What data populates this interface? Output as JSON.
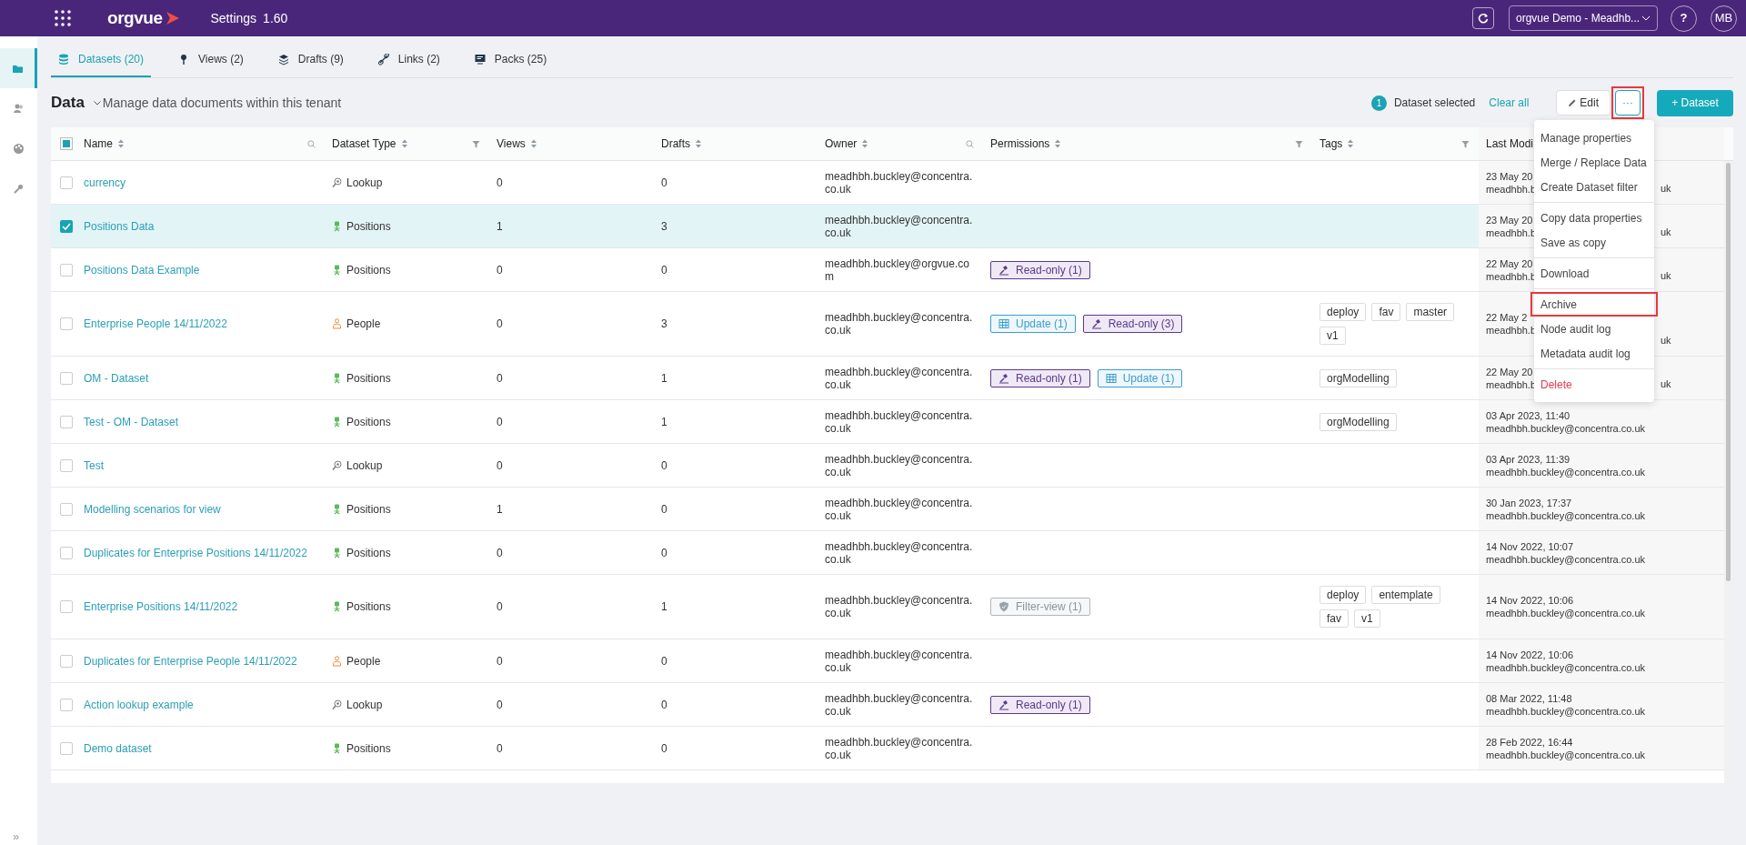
{
  "topbar": {
    "logo": "orgvue",
    "title": "Settings",
    "version": "1.60",
    "tenant": "orgvue Demo - Meadhb...",
    "help": "?",
    "avatar": "MB"
  },
  "sidebar": {
    "items": [
      {
        "kind": "folder",
        "selected": true
      },
      {
        "kind": "people",
        "selected": false
      },
      {
        "kind": "palette",
        "selected": false
      },
      {
        "kind": "wrench",
        "selected": false
      }
    ],
    "expand": "»"
  },
  "tabs": [
    {
      "kind": "database",
      "label": "Datasets (20)",
      "selected": true
    },
    {
      "kind": "pin",
      "label": "Views (2)",
      "selected": false
    },
    {
      "kind": "layers",
      "label": "Drafts (9)",
      "selected": false
    },
    {
      "kind": "link",
      "label": "Links (2)",
      "selected": false
    },
    {
      "kind": "monitor",
      "label": "Packs (25)",
      "selected": false
    }
  ],
  "header": {
    "title": "Data",
    "subtitle": "Manage data documents within this tenant",
    "selected_count": "1",
    "selected_label": "Dataset selected",
    "clear": "Clear all",
    "edit": "Edit",
    "more": {
      "label": "···",
      "highlighted": true
    },
    "add": "+ Dataset"
  },
  "table": {
    "select_all_partial": true,
    "columns": [
      {
        "label": "Name",
        "searchable": true,
        "filterable": false
      },
      {
        "label": "Dataset Type",
        "searchable": false,
        "filterable": true
      },
      {
        "label": "Views",
        "searchable": false,
        "filterable": false
      },
      {
        "label": "Drafts",
        "searchable": false,
        "filterable": false
      },
      {
        "label": "Owner",
        "searchable": true,
        "filterable": false
      },
      {
        "label": "Permissions",
        "searchable": false,
        "filterable": true
      },
      {
        "label": "Tags",
        "searchable": false,
        "filterable": true
      },
      {
        "label": "Last Modi",
        "searchable": false,
        "filterable": false
      }
    ],
    "rows": [
      {
        "name": "currency",
        "selected": false,
        "type": {
          "kind": "lookup",
          "label": "Lookup"
        },
        "views": "0",
        "drafts": "0",
        "owner": "meadhbh.buckley@concentra.co.uk",
        "modified": "23 May 20",
        "modified_by": "meadhbh.b",
        "modified_by_tail": "uk"
      },
      {
        "name": "Positions Data",
        "selected": true,
        "type": {
          "kind": "positions",
          "label": "Positions"
        },
        "views": "1",
        "drafts": "3",
        "owner": "meadhbh.buckley@concentra.co.uk",
        "modified": "23 May 20",
        "modified_by": "meadhbh.b",
        "modified_by_tail": "uk"
      },
      {
        "name": "Positions Data Example",
        "selected": false,
        "type": {
          "kind": "positions",
          "label": "Positions"
        },
        "views": "0",
        "drafts": "0",
        "owner": "meadhbh.buckley@orgvue.com",
        "permissions": [
          {
            "kind": "read-only",
            "label": "Read-only (1)"
          }
        ],
        "modified": "22 May 20",
        "modified_by": "meadhbh.b",
        "modified_by_tail": "uk"
      },
      {
        "name": "Enterprise People 14/11/2022",
        "selected": false,
        "type": {
          "kind": "people",
          "label": "People"
        },
        "views": "0",
        "drafts": "3",
        "owner": "meadhbh.buckley@concentra.co.uk",
        "permissions": [
          {
            "kind": "update",
            "label": "Update (1)"
          },
          {
            "kind": "read-only",
            "label": "Read-only (3)"
          }
        ],
        "tags": [
          "deploy",
          "fav",
          "master",
          "v1"
        ],
        "modified": "22 May 2",
        "modified_by": "meadhbh.b",
        "modified_by_tail": "uk"
      },
      {
        "name": "OM - Dataset",
        "selected": false,
        "type": {
          "kind": "positions",
          "label": "Positions"
        },
        "views": "0",
        "drafts": "1",
        "owner": "meadhbh.buckley@concentra.co.uk",
        "permissions": [
          {
            "kind": "read-only",
            "label": "Read-only (1)"
          },
          {
            "kind": "update",
            "label": "Update (1)"
          }
        ],
        "tags": [
          "orgModelling"
        ],
        "modified": "22 May 20",
        "modified_by": "meadhbh.b",
        "modified_by_tail": "uk"
      },
      {
        "name": "Test - OM - Dataset",
        "selected": false,
        "type": {
          "kind": "positions",
          "label": "Positions"
        },
        "views": "0",
        "drafts": "1",
        "owner": "meadhbh.buckley@concentra.co.uk",
        "tags": [
          "orgModelling"
        ],
        "modified": "03 Apr 2023, 11:40",
        "modified_by": "meadhbh.buckley@concentra.co.uk"
      },
      {
        "name": "Test",
        "selected": false,
        "type": {
          "kind": "lookup",
          "label": "Lookup"
        },
        "views": "0",
        "drafts": "0",
        "owner": "meadhbh.buckley@concentra.co.uk",
        "modified": "03 Apr 2023, 11:39",
        "modified_by": "meadhbh.buckley@concentra.co.uk"
      },
      {
        "name": "Modelling scenarios for view",
        "selected": false,
        "type": {
          "kind": "positions",
          "label": "Positions"
        },
        "views": "1",
        "drafts": "0",
        "owner": "meadhbh.buckley@concentra.co.uk",
        "modified": "30 Jan 2023, 17:37",
        "modified_by": "meadhbh.buckley@concentra.co.uk"
      },
      {
        "name": "Duplicates for Enterprise Positions 14/11/2022",
        "selected": false,
        "type": {
          "kind": "positions",
          "label": "Positions"
        },
        "views": "0",
        "drafts": "0",
        "owner": "meadhbh.buckley@concentra.co.uk",
        "modified": "14 Nov 2022, 10:07",
        "modified_by": "meadhbh.buckley@concentra.co.uk"
      },
      {
        "name": "Enterprise Positions 14/11/2022",
        "selected": false,
        "type": {
          "kind": "positions",
          "label": "Positions"
        },
        "views": "0",
        "drafts": "1",
        "owner": "meadhbh.buckley@concentra.co.uk",
        "permissions": [
          {
            "kind": "filter-view",
            "label": "Filter-view (1)"
          }
        ],
        "tags": [
          "deploy",
          "entemplate",
          "fav",
          "v1"
        ],
        "modified": "14 Nov 2022, 10:06",
        "modified_by": "meadhbh.buckley@concentra.co.uk"
      },
      {
        "name": "Duplicates for Enterprise People 14/11/2022",
        "selected": false,
        "type": {
          "kind": "people",
          "label": "People"
        },
        "views": "0",
        "drafts": "0",
        "owner": "meadhbh.buckley@concentra.co.uk",
        "modified": "14 Nov 2022, 10:06",
        "modified_by": "meadhbh.buckley@concentra.co.uk"
      },
      {
        "name": "Action lookup example",
        "selected": false,
        "type": {
          "kind": "lookup",
          "label": "Lookup"
        },
        "views": "0",
        "drafts": "0",
        "owner": "meadhbh.buckley@concentra.co.uk",
        "permissions": [
          {
            "kind": "read-only",
            "label": "Read-only (1)"
          }
        ],
        "modified": "08 Mar 2022, 11:48",
        "modified_by": "meadhbh.buckley@concentra.co.uk"
      },
      {
        "name": "Demo dataset",
        "selected": false,
        "type": {
          "kind": "positions",
          "label": "Positions"
        },
        "views": "0",
        "drafts": "0",
        "owner": "meadhbh.buckley@concentra.co.uk",
        "modified": "28 Feb 2022, 16:44",
        "modified_by": "meadhbh.buckley@concentra.co.uk"
      }
    ]
  },
  "menu": {
    "groups": [
      [
        {
          "label": "Manage properties",
          "kind": "normal",
          "highlighted": false
        },
        {
          "label": "Merge / Replace Data",
          "kind": "normal",
          "highlighted": false
        },
        {
          "label": "Create Dataset filter",
          "kind": "normal",
          "highlighted": false
        }
      ],
      [
        {
          "label": "Copy data properties",
          "kind": "normal",
          "highlighted": false
        },
        {
          "label": "Save as copy",
          "kind": "normal",
          "highlighted": false
        }
      ],
      [
        {
          "label": "Download",
          "kind": "normal",
          "highlighted": false
        }
      ],
      [
        {
          "label": "Archive",
          "kind": "normal",
          "highlighted": true
        },
        {
          "label": "Node audit log",
          "kind": "normal",
          "highlighted": false
        },
        {
          "label": "Metadata audit log",
          "kind": "normal",
          "highlighted": false
        }
      ],
      [
        {
          "label": "Delete",
          "kind": "danger",
          "highlighted": false
        }
      ]
    ]
  }
}
